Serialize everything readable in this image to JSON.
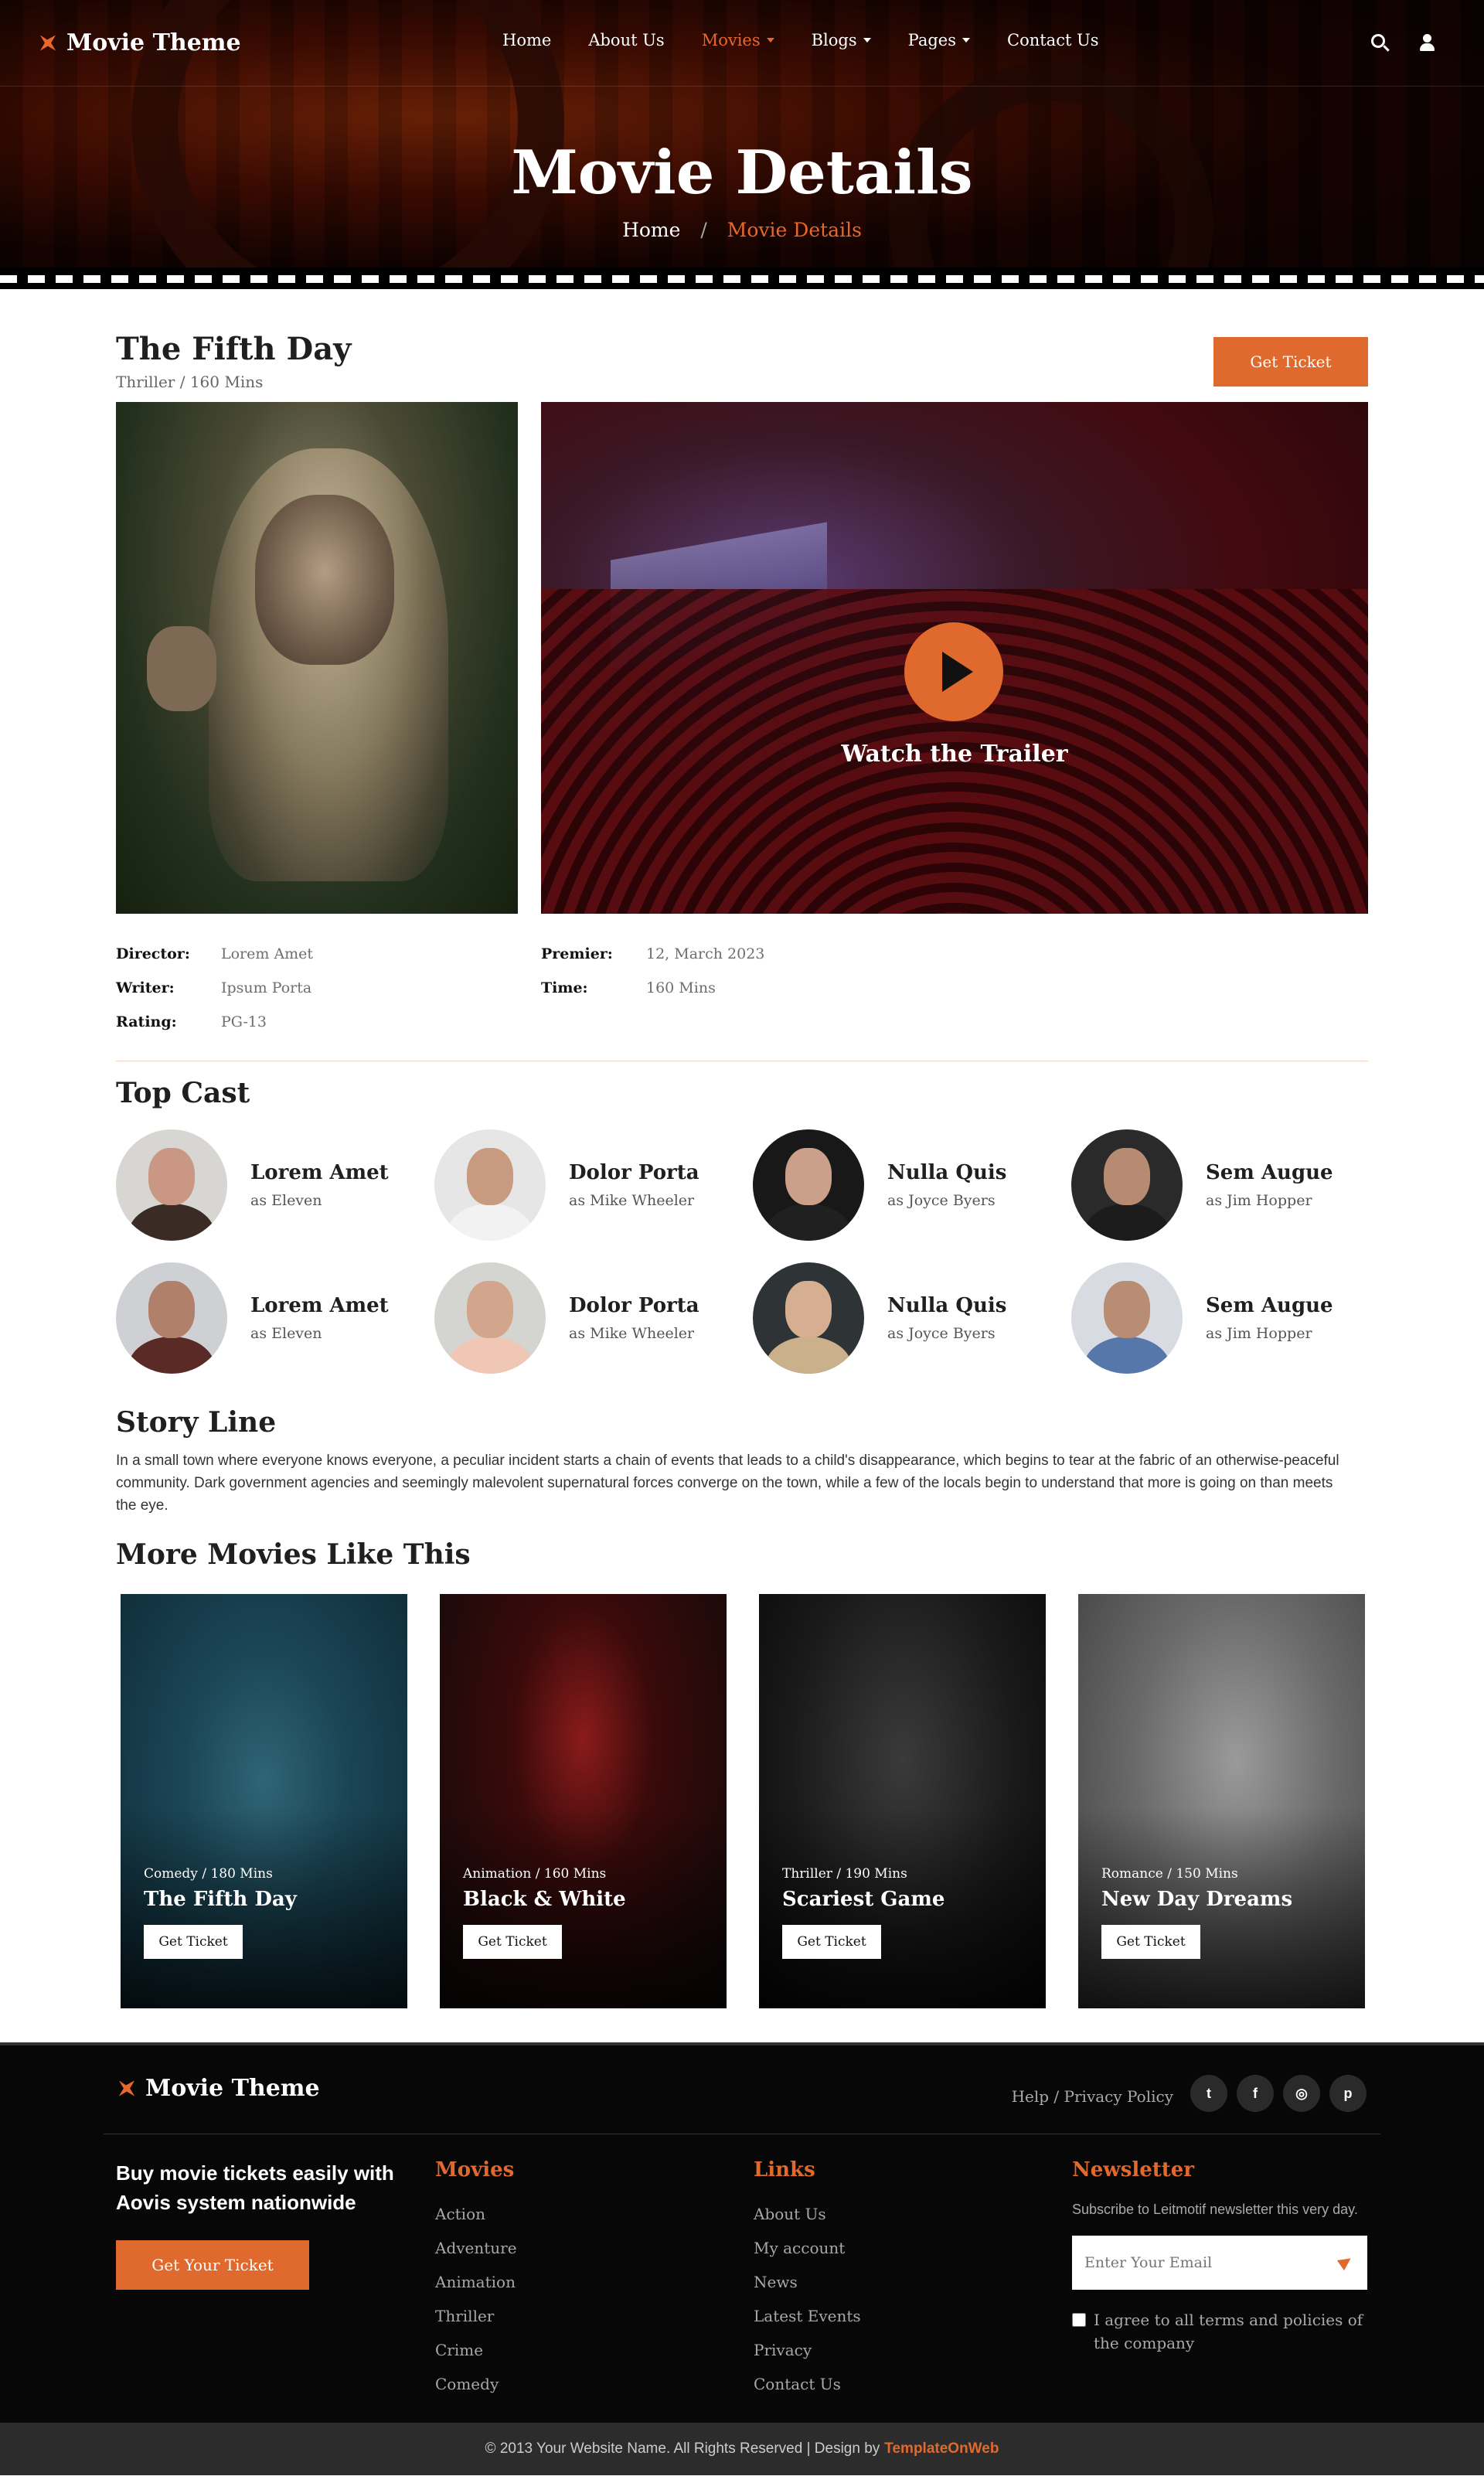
{
  "brand": {
    "name": "Movie Theme",
    "accent": "#e0692d"
  },
  "nav": {
    "items": [
      {
        "label": "Home",
        "dropdown": false,
        "active": false
      },
      {
        "label": "About Us",
        "dropdown": false,
        "active": false
      },
      {
        "label": "Movies",
        "dropdown": true,
        "active": true
      },
      {
        "label": "Blogs",
        "dropdown": true,
        "active": false
      },
      {
        "label": "Pages",
        "dropdown": true,
        "active": false
      },
      {
        "label": "Contact Us",
        "dropdown": false,
        "active": false
      }
    ],
    "icons": [
      "search-icon",
      "user-icon"
    ]
  },
  "hero": {
    "title": "Movie Details",
    "breadcrumb": {
      "home": "Home",
      "separator": "/",
      "current": "Movie Details"
    }
  },
  "movie": {
    "title": "The Fifth Day",
    "meta": "Thriller / 160 Mins",
    "ticket_label": "Get Ticket",
    "trailer_label": "Watch the Trailer",
    "details_left": [
      {
        "key": "Director:",
        "value": "Lorem Amet"
      },
      {
        "key": "Writer:",
        "value": "Ipsum Porta"
      },
      {
        "key": "Rating:",
        "value": "PG-13"
      }
    ],
    "details_right": [
      {
        "key": "Premier:",
        "value": "12, March 2023"
      },
      {
        "key": "Time:",
        "value": "160 Mins"
      }
    ]
  },
  "cast": {
    "title": "Top Cast",
    "members": [
      {
        "name": "Lorem Amet",
        "role": "as Eleven"
      },
      {
        "name": "Dolor Porta",
        "role": "as Mike Wheeler"
      },
      {
        "name": "Nulla Quis",
        "role": "as Joyce Byers"
      },
      {
        "name": "Sem Augue",
        "role": "as Jim Hopper"
      },
      {
        "name": "Lorem Amet",
        "role": "as Eleven"
      },
      {
        "name": "Dolor Porta",
        "role": "as Mike Wheeler"
      },
      {
        "name": "Nulla Quis",
        "role": "as Joyce Byers"
      },
      {
        "name": "Sem Augue",
        "role": "as Jim Hopper"
      }
    ]
  },
  "story": {
    "title": "Story Line",
    "text": "In a small town where everyone knows everyone, a peculiar incident starts a chain of events that leads to a child's disappearance, which begins to tear at the fabric of an otherwise-peaceful community. Dark government agencies and seemingly malevolent supernatural forces converge on the town, while a few of the locals begin to understand that more is going on than meets the eye."
  },
  "more": {
    "title": "More Movies Like This",
    "movies": [
      {
        "meta": "Comedy / 180 Mins",
        "title": "The Fifth Day",
        "button": "Get Ticket"
      },
      {
        "meta": "Animation / 160 Mins",
        "title": "Black & White",
        "button": "Get Ticket"
      },
      {
        "meta": "Thriller / 190 Mins",
        "title": "Scariest Game",
        "button": "Get Ticket"
      },
      {
        "meta": "Romance / 150 Mins",
        "title": "New Day Dreams",
        "button": "Get Ticket"
      }
    ]
  },
  "footer": {
    "brand": "Movie Theme",
    "top_links": "Help / Privacy Policy",
    "social": [
      {
        "icon": "twitter-icon",
        "glyph": "t"
      },
      {
        "icon": "facebook-icon",
        "glyph": "f"
      },
      {
        "icon": "instagram-icon",
        "glyph": "◎"
      },
      {
        "icon": "pinterest-icon",
        "glyph": "p"
      }
    ],
    "pitch": "Buy movie tickets easily with Aovis system nationwide",
    "cta": "Get Your Ticket",
    "movies_title": "Movies",
    "movies_links": [
      "Action",
      "Adventure",
      "Animation",
      "Thriller",
      "Crime",
      "Comedy"
    ],
    "links_title": "Links",
    "links": [
      "About Us",
      "My account",
      "News",
      "Latest Events",
      "Privacy",
      "Contact Us"
    ],
    "newsletter_title": "Newsletter",
    "newsletter_text": "Subscribe to Leitmotif newsletter this very day.",
    "email_placeholder": "Enter Your Email",
    "agree_text": "I agree to all terms and policies of the company",
    "copyright": "© 2013 Your Website Name. All Rights Reserved | Design by",
    "copyright_brand": "TemplateOnWeb"
  }
}
